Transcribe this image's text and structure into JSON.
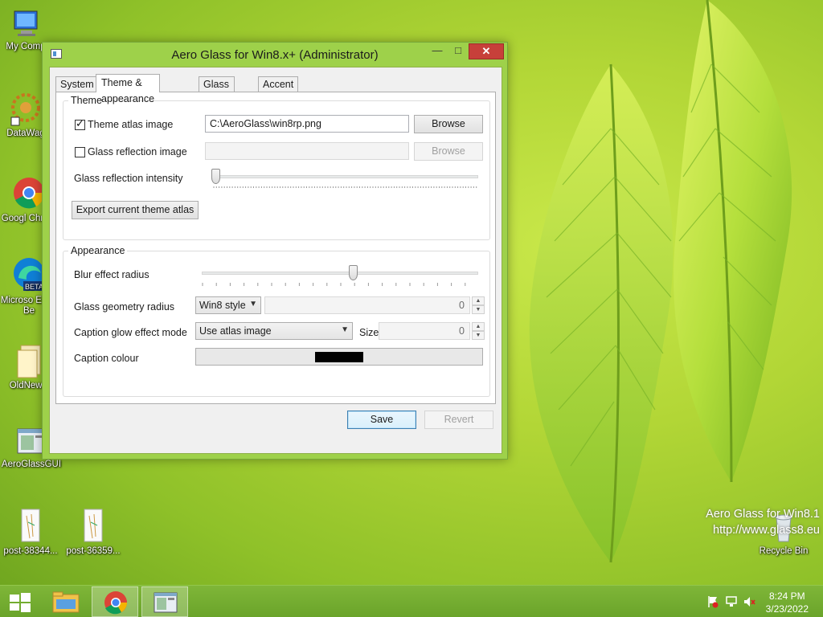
{
  "desktop": {
    "icons": [
      {
        "label": "My Comp"
      },
      {
        "label": "DataWag"
      },
      {
        "label": "Googl Chrom"
      },
      {
        "label": "Microso Edge Be"
      },
      {
        "label": "OldNewE"
      },
      {
        "label": "AeroGlassGUI"
      },
      {
        "label": "post-38344..."
      },
      {
        "label": "post-36359..."
      },
      {
        "label": "Recycle Bin"
      }
    ],
    "watermark_line1": "Aero Glass for Win8.1",
    "watermark_line2": "http://www.glass8.eu"
  },
  "window": {
    "title": "Aero Glass for Win8.x+ (Administrator)",
    "min_glyph": "—",
    "max_glyph": "□",
    "close_glyph": "✕",
    "tabs": [
      {
        "label": "System"
      },
      {
        "label": "Theme & appearance"
      },
      {
        "label": "Glass colors"
      },
      {
        "label": "Accent"
      }
    ],
    "theme_group": {
      "legend": "Theme",
      "atlas_label": "Theme atlas image",
      "atlas_checked": true,
      "atlas_path": "C:\\AeroGlass\\win8rp.png",
      "browse_label": "Browse",
      "reflection_label": "Glass reflection image",
      "reflection_checked": false,
      "reflection_path": "",
      "browse2_label": "Browse",
      "intensity_label": "Glass reflection intensity",
      "intensity_value": 0,
      "export_label": "Export current theme atlas"
    },
    "appearance_group": {
      "legend": "Appearance",
      "blur_label": "Blur effect radius",
      "blur_value": 0.55,
      "geometry_label": "Glass geometry radius",
      "geometry_option": "Win8 style",
      "geometry_value": "0",
      "glow_label": "Caption glow effect mode",
      "glow_option": "Use atlas image",
      "size_label": "Size",
      "size_value": "0",
      "caption_colour_label": "Caption colour",
      "caption_colour": "#000000"
    },
    "save_label": "Save",
    "revert_label": "Revert"
  },
  "taskbar": {
    "time": "8:24 PM",
    "date": "3/23/2022"
  },
  "colors": {
    "accent": "#9ed14a",
    "close": "#c7403a",
    "taskbar": "#6aa42a"
  }
}
